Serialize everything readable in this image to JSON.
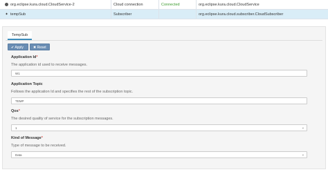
{
  "services": [
    {
      "name": "org.eclipse.kura.cloud.CloudService-2",
      "type": "Cloud connection",
      "status": "Connected",
      "factory": "org.eclipse.kura.cloud.CloudService"
    },
    {
      "name": "tempSub",
      "type": "Subscriber",
      "status": "",
      "factory": "org.eclipse.kura.cloud.subscriber.CloudSubscriber"
    }
  ],
  "panel": {
    "tab_label": "TempSub",
    "apply_label": "Apply",
    "reset_label": "Reset"
  },
  "fields": {
    "app_id": {
      "label": "Application Id",
      "required": "*",
      "hint": "The application id used to receive messages.",
      "value": "W1"
    },
    "app_topic": {
      "label": "Application Topic",
      "required": "",
      "hint": "Follows the application Id and specifies the rest of the subscription topic.",
      "value": "TEMP"
    },
    "qos": {
      "label": "Qos",
      "required": "*",
      "hint": "The desired quality of service for the subscription messages.",
      "value": "1"
    },
    "kind": {
      "label": "Kind of Message",
      "required": "*",
      "hint": "Type of message to be received.",
      "value": "Data"
    }
  },
  "icons": {
    "service_row_1": "circle-icon",
    "service_row_2": "plug-icon",
    "apply": "check-icon",
    "reset": "x-icon",
    "dropdown": "chevron-down-icon"
  },
  "colors": {
    "selected_row": "#d9edf7",
    "connected": "#3c9b2e",
    "button": "#6a8db3",
    "required": "#d9534f"
  }
}
